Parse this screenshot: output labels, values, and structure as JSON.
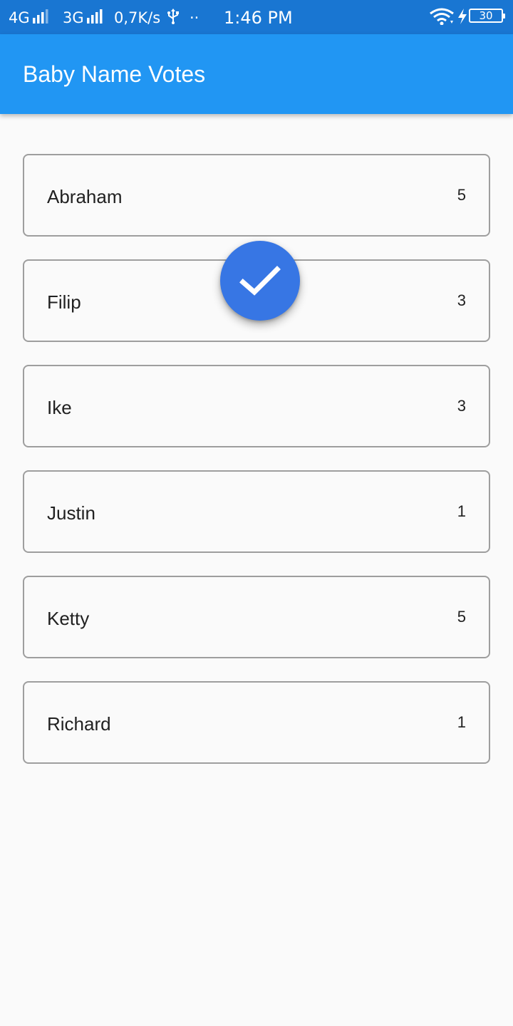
{
  "status_bar": {
    "network1": "4G",
    "network2": "3G",
    "speed": "0,7K/s",
    "usb_icon": "usb-icon",
    "dots": "··",
    "time": "1:46 PM",
    "wifi_icon": "wifi-icon",
    "charging_icon": "lightning-icon",
    "battery": "30"
  },
  "app_bar": {
    "title": "Baby Name Votes"
  },
  "names": [
    {
      "name": "Abraham",
      "votes": "5"
    },
    {
      "name": "Filip",
      "votes": "3"
    },
    {
      "name": "Ike",
      "votes": "3"
    },
    {
      "name": "Justin",
      "votes": "1"
    },
    {
      "name": "Ketty",
      "votes": "5"
    },
    {
      "name": "Richard",
      "votes": "1"
    }
  ],
  "fab": {
    "icon": "check-icon"
  },
  "colors": {
    "status_bar": "#1976d2",
    "app_bar": "#2196f3",
    "fab": "#3776e4",
    "card_border": "#9e9e9e",
    "background": "#fafafa"
  }
}
